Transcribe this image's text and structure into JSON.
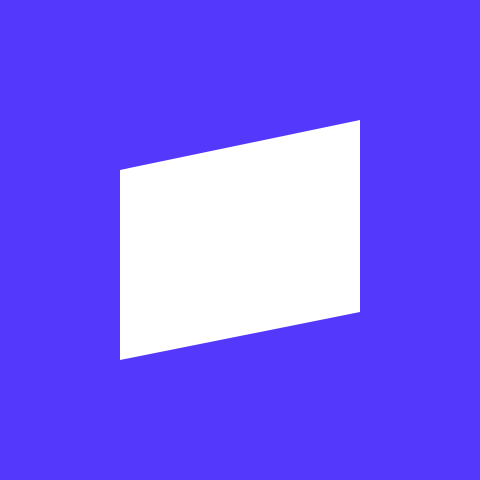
{
  "app_icon": {
    "background_color": "#5438fb",
    "mark_color": "#ffffff",
    "icon": "slanted-panel-icon"
  }
}
